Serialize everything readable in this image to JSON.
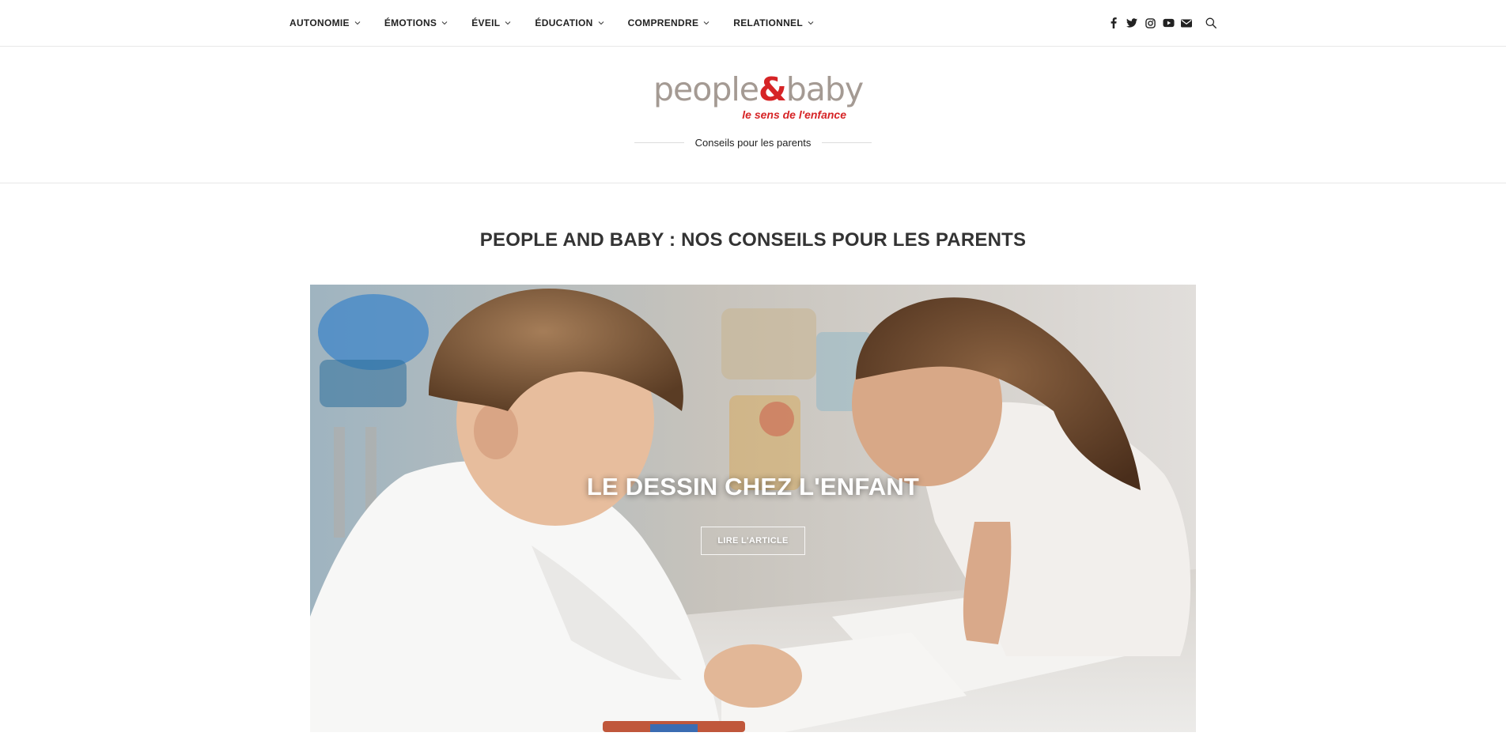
{
  "nav": {
    "items": [
      {
        "label": "AUTONOMIE"
      },
      {
        "label": "ÉMOTIONS"
      },
      {
        "label": "ÉVEIL"
      },
      {
        "label": "ÉDUCATION"
      },
      {
        "label": "COMPRENDRE"
      },
      {
        "label": "RELATIONNEL"
      }
    ]
  },
  "social": {
    "icons": [
      "facebook-icon",
      "twitter-icon",
      "instagram-icon",
      "youtube-icon",
      "email-icon",
      "search-icon"
    ]
  },
  "header": {
    "logo_left": "people",
    "logo_amp": "&",
    "logo_right": "baby",
    "logo_subtitle": "le sens de l'enfance",
    "tagline": "Conseils pour les parents"
  },
  "main": {
    "title": "PEOPLE AND BABY : NOS CONSEILS POUR LES PARENTS",
    "hero": {
      "title": "LE DESSIN CHEZ L'ENFANT",
      "button_label": "LIRE L'ARTICLE"
    }
  },
  "colors": {
    "logo_grey": "#a49a93",
    "logo_red": "#d62426",
    "text_dark": "#333333"
  }
}
